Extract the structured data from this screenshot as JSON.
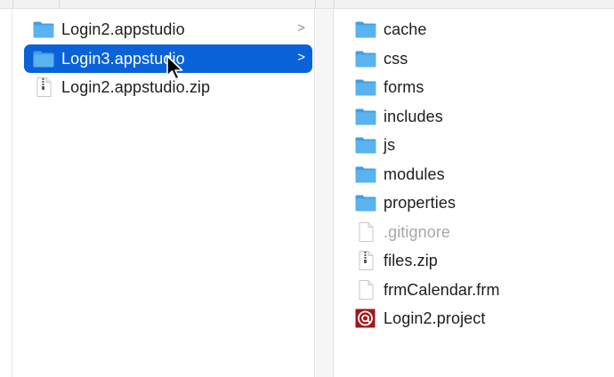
{
  "column1": {
    "items": [
      {
        "label": "Login2.appstudio",
        "icon": "folder-icon",
        "has_children": true,
        "selected": false
      },
      {
        "label": "Login3.appstudio",
        "icon": "folder-icon",
        "has_children": true,
        "selected": true
      },
      {
        "label": "Login2.appstudio.zip",
        "icon": "zip-file-icon",
        "has_children": false,
        "selected": false
      }
    ]
  },
  "column2": {
    "items": [
      {
        "label": "cache",
        "icon": "folder-icon",
        "has_children": true,
        "dimmed": false
      },
      {
        "label": "css",
        "icon": "folder-icon",
        "has_children": true,
        "dimmed": false
      },
      {
        "label": "forms",
        "icon": "folder-icon",
        "has_children": true,
        "dimmed": false
      },
      {
        "label": "includes",
        "icon": "folder-icon",
        "has_children": true,
        "dimmed": false
      },
      {
        "label": "js",
        "icon": "folder-icon",
        "has_children": true,
        "dimmed": false
      },
      {
        "label": "modules",
        "icon": "folder-icon",
        "has_children": true,
        "dimmed": false
      },
      {
        "label": "properties",
        "icon": "folder-icon",
        "has_children": true,
        "dimmed": false
      },
      {
        "label": ".gitignore",
        "icon": "document-icon",
        "has_children": false,
        "dimmed": true
      },
      {
        "label": "files.zip",
        "icon": "zip-file-icon",
        "has_children": false,
        "dimmed": false
      },
      {
        "label": "frmCalendar.frm",
        "icon": "document-icon",
        "has_children": false,
        "dimmed": false
      },
      {
        "label": "Login2.project",
        "icon": "appstudio-project-icon",
        "has_children": false,
        "dimmed": false
      }
    ]
  },
  "chevron_glyph": ">",
  "colors": {
    "selection": "#0a62d9",
    "folder": "#5ab3ee",
    "dimmed_text": "#a8a8a8",
    "project_icon": "#a31515"
  }
}
